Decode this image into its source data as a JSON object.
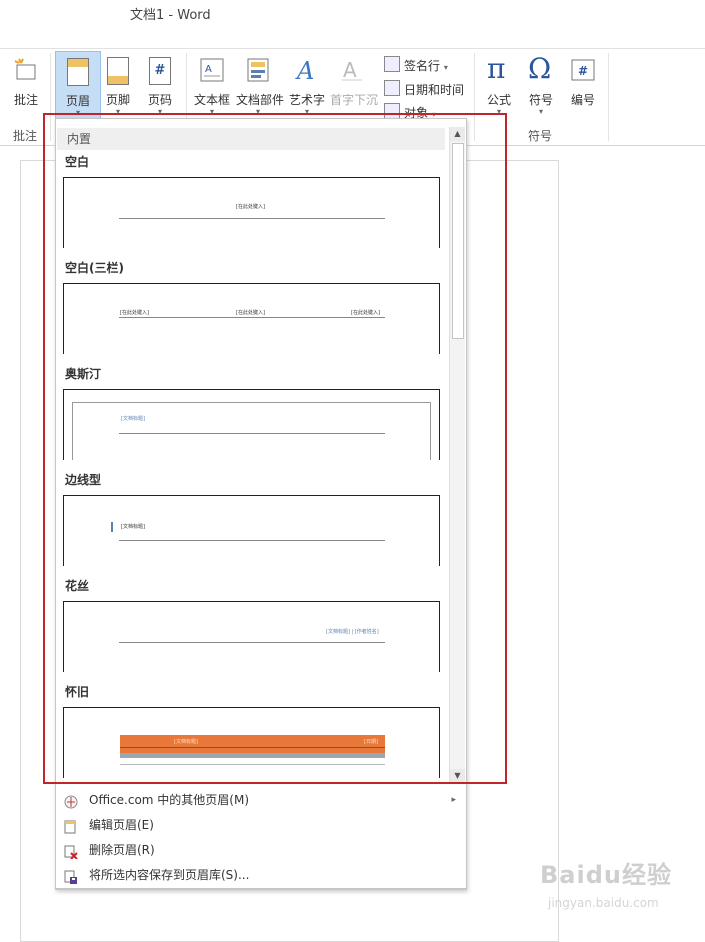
{
  "window": {
    "title": "文档1 - Word"
  },
  "ribbon": {
    "comment": {
      "label": "批注",
      "group": "批注"
    },
    "header": {
      "label": "页眉",
      "arrow": "▾"
    },
    "footer": {
      "label": "页脚",
      "arrow": "▾"
    },
    "page_number": {
      "label": "页码",
      "arrow": "▾"
    },
    "textbox": {
      "label": "文本框",
      "arrow": "▾"
    },
    "quick_parts": {
      "label": "文档部件",
      "arrow": "▾"
    },
    "wordart": {
      "label": "艺术字",
      "arrow": "▾"
    },
    "dropcap": {
      "label": "首字下沉"
    },
    "signature": {
      "label": "签名行",
      "arrow": "▾"
    },
    "datetime": {
      "label": "日期和时间"
    },
    "object": {
      "label": "对象",
      "arrow": "▾"
    },
    "equation": {
      "label": "公式",
      "arrow": "▾"
    },
    "symbol": {
      "label": "符号",
      "arrow": "▾"
    },
    "number": {
      "label": "编号"
    },
    "symbols_group": "符号"
  },
  "gallery": {
    "category": "内置",
    "items": [
      {
        "name": "空白",
        "placeholder": "[在此处键入]"
      },
      {
        "name": "空白(三栏)",
        "placeholders": [
          "[在此处键入]",
          "[在此处键入]",
          "[在此处键入]"
        ]
      },
      {
        "name": "奥斯汀",
        "placeholder": "[文档标题]"
      },
      {
        "name": "边线型",
        "placeholder": "[文档标题]"
      },
      {
        "name": "花丝",
        "placeholder": "[文档标题] | [作者姓名]"
      },
      {
        "name": "怀旧",
        "placeholders": [
          "[文档标题]",
          "[日期]"
        ]
      }
    ],
    "accent_color": "#e8773a"
  },
  "menu": {
    "items": [
      {
        "label": "Office.com 中的其他页眉(M)"
      },
      {
        "label": "编辑页眉(E)"
      },
      {
        "label": "删除页眉(R)"
      },
      {
        "label": "将所选内容保存到页眉库(S)..."
      }
    ],
    "submenu_arrow": "▸"
  },
  "watermark": {
    "text": "Baidu经验",
    "sub": "jingyan.baidu.com"
  }
}
